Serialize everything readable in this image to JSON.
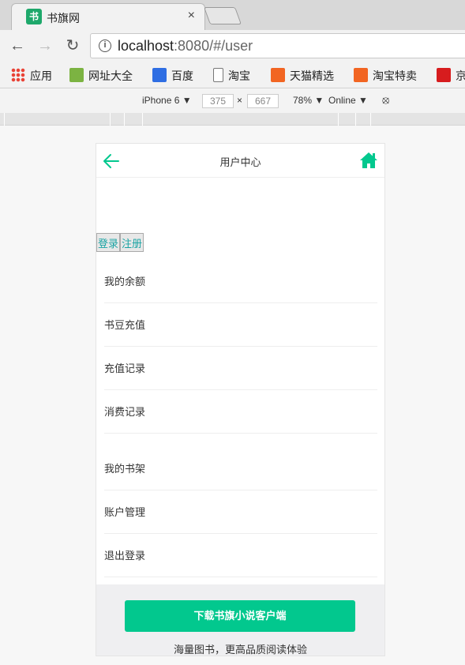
{
  "browser": {
    "tab_title": "书旗网",
    "tab_favicon_text": "书",
    "tab_close": "×",
    "url_host": "localhost",
    "url_rest": ":8080/#/user",
    "bookmarks": [
      {
        "label": "应用",
        "icon": "apps-grid-icon"
      },
      {
        "label": "网址大全",
        "icon": "hao-icon"
      },
      {
        "label": "百度",
        "icon": "baidu-paw-icon"
      },
      {
        "label": "淘宝",
        "icon": "page-icon"
      },
      {
        "label": "天猫精选",
        "icon": "taobao-icon"
      },
      {
        "label": "淘宝特卖",
        "icon": "taobao-icon"
      },
      {
        "label": "京",
        "icon": "jd-icon"
      }
    ]
  },
  "devtools": {
    "device": "iPhone 6",
    "width": "375",
    "height": "667",
    "times": "×",
    "zoom": "78%",
    "network": "Online"
  },
  "app": {
    "header_title": "用户中心",
    "login_label": "登录",
    "register_label": "注册",
    "menu_group_1": [
      "我的余额",
      "书豆充值",
      "充值记录",
      "消费记录"
    ],
    "menu_group_2": [
      "我的书架",
      "账户管理",
      "退出登录"
    ],
    "download_button": "下载书旗小说客户端",
    "slogan": "海量图书，更高品质阅读体验",
    "accent_color": "#02c88e"
  }
}
